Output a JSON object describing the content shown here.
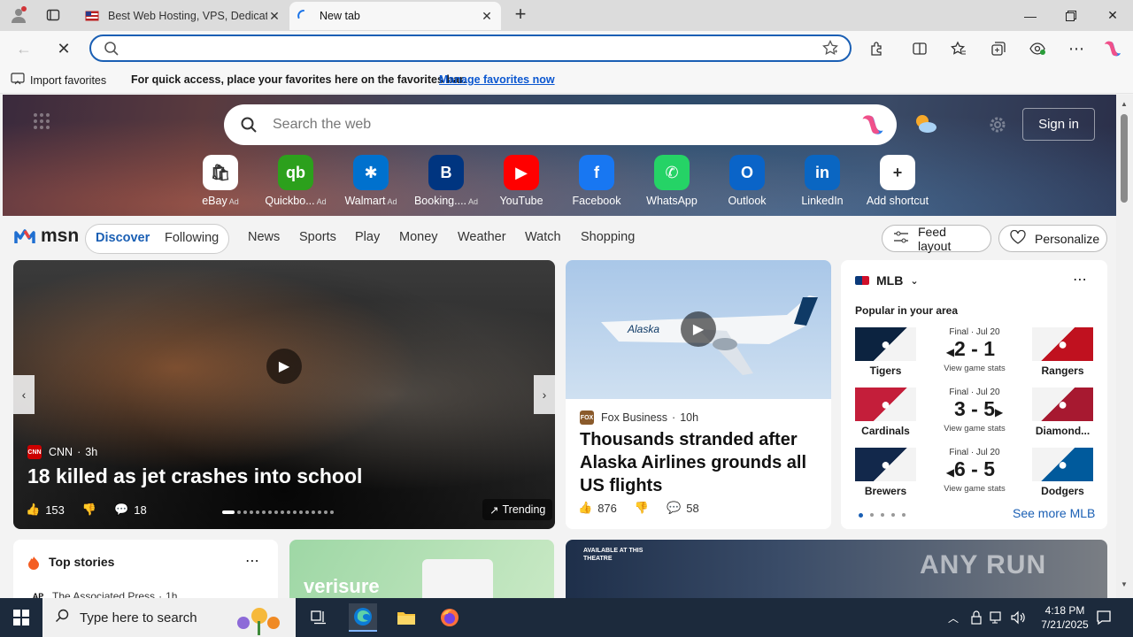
{
  "browser": {
    "tabs": [
      {
        "title": "Best Web Hosting, VPS, Dedicate",
        "active": false
      },
      {
        "title": "New tab",
        "active": true
      }
    ],
    "address": {
      "value": "",
      "placeholder": ""
    },
    "favorites_bar": {
      "import_label": "Import favorites",
      "message": "For quick access, place your favorites here on the favorites bar.",
      "manage_link": "Manage favorites now"
    }
  },
  "newtab": {
    "search_placeholder": "Search the web",
    "signin_label": "Sign in",
    "shortcuts": [
      {
        "label": "eBay",
        "ad": "Ad",
        "color": "#ffffff",
        "icon": "ebay-icon"
      },
      {
        "label": "Quickbo...",
        "ad": "Ad",
        "color": "#2ca01c",
        "icon": "quickbooks-icon"
      },
      {
        "label": "Walmart",
        "ad": "Ad",
        "color": "#0071ce",
        "icon": "walmart-icon"
      },
      {
        "label": "Booking....",
        "ad": "Ad",
        "color": "#003580",
        "icon": "booking-icon"
      },
      {
        "label": "YouTube",
        "ad": "",
        "color": "#ff0000",
        "icon": "youtube-icon"
      },
      {
        "label": "Facebook",
        "ad": "",
        "color": "#1877f2",
        "icon": "facebook-icon"
      },
      {
        "label": "WhatsApp",
        "ad": "",
        "color": "#25d366",
        "icon": "whatsapp-icon"
      },
      {
        "label": "Outlook",
        "ad": "",
        "color": "#0a64c8",
        "icon": "outlook-icon"
      },
      {
        "label": "LinkedIn",
        "ad": "",
        "color": "#0a66c2",
        "icon": "linkedin-icon"
      },
      {
        "label": "Add shortcut",
        "ad": "",
        "color": "#ffffff",
        "icon": "plus-icon"
      }
    ]
  },
  "msn": {
    "logo": "msn",
    "feed_tabs": [
      "Discover",
      "Following"
    ],
    "nav": [
      "News",
      "Sports",
      "Play",
      "Money",
      "Weather",
      "Watch",
      "Shopping"
    ],
    "feed_layout": "Feed layout",
    "personalize": "Personalize"
  },
  "cards": {
    "main": {
      "source": "CNN",
      "age": "3h",
      "headline": "18 killed as jet crashes into school",
      "likes": "153",
      "comments": "18",
      "trending": "Trending"
    },
    "alaska": {
      "source": "Fox Business",
      "age": "10h",
      "headline": "Thousands stranded after Alaska Airlines grounds all US flights",
      "likes": "876",
      "comments": "58"
    },
    "mlb": {
      "title": "MLB",
      "subtitle": "Popular in your area",
      "see_more": "See more MLB",
      "games": [
        {
          "status": "Final · Jul 20",
          "home": "Tigers",
          "away": "Rangers",
          "score": "2 - 1",
          "winner": "left",
          "view": "View game stats",
          "home_color": "#0c2340",
          "away_color": "#c0111f"
        },
        {
          "status": "Final · Jul 20",
          "home": "Cardinals",
          "away": "Diamond...",
          "score": "3 - 5",
          "winner": "right",
          "view": "View game stats",
          "home_color": "#c41e3a",
          "away_color": "#a71930"
        },
        {
          "status": "Final · Jul 20",
          "home": "Brewers",
          "away": "Dodgers",
          "score": "6 - 5",
          "winner": "left",
          "view": "View game stats",
          "home_color": "#12284b",
          "away_color": "#005a9c"
        }
      ]
    },
    "top_stories": {
      "title": "Top stories",
      "source": "The Associated Press",
      "age": "1h"
    },
    "verisure": {
      "brand": "verisure"
    },
    "theatre": {
      "text": "AVAILABLE AT THIS THEATRE"
    }
  },
  "watermark": "ANY RUN",
  "taskbar": {
    "search_placeholder": "Type here to search",
    "time": "4:18 PM",
    "date": "7/21/2025"
  }
}
